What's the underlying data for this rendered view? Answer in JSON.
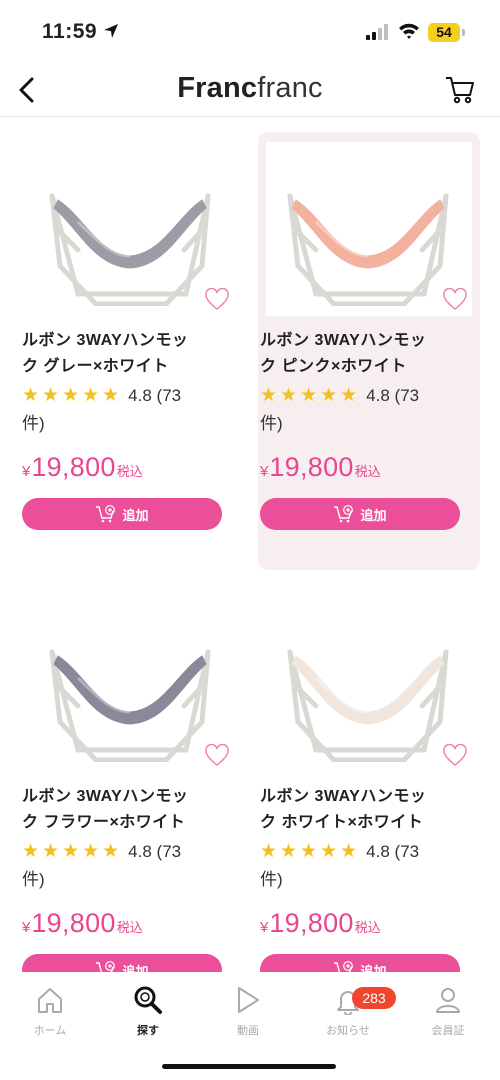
{
  "status": {
    "time": "11:59",
    "battery": "54"
  },
  "header": {
    "logo_bold": "Franc",
    "logo_thin": "franc"
  },
  "colors": {
    "accent": "#ec4f99",
    "price": "#e8468f",
    "star": "#f2c11d",
    "badge": "#f0452f",
    "selected_card_bg": "#f7efef"
  },
  "products": [
    {
      "name_line1": "ルボン 3WAYハンモッ",
      "name_line2": "ク グレー×ホワイト",
      "stars": "★★★★★",
      "rating": "4.8 (73",
      "rating_line2": "件)",
      "yen": "¥",
      "price": "19,800",
      "tax": "税込",
      "add_label": "追加",
      "fabric_color": "#9e9ba6",
      "selected": false
    },
    {
      "name_line1": "ルボン 3WAYハンモッ",
      "name_line2": "ク ピンク×ホワイト",
      "stars": "★★★★★",
      "rating": "4.8 (73",
      "rating_line2": "件)",
      "yen": "¥",
      "price": "19,800",
      "tax": "税込",
      "add_label": "追加",
      "fabric_color": "#f3b2a0",
      "selected": true
    },
    {
      "name_line1": "ルボン 3WAYハンモッ",
      "name_line2": "ク フラワー×ホワイト",
      "stars": "★★★★★",
      "rating": "4.8 (73",
      "rating_line2": "件)",
      "yen": "¥",
      "price": "19,800",
      "tax": "税込",
      "add_label": "追加",
      "fabric_color": "#8c8899",
      "selected": false
    },
    {
      "name_line1": "ルボン 3WAYハンモッ",
      "name_line2": "ク ホワイト×ホワイト",
      "stars": "★★★★★",
      "rating": "4.8 (73",
      "rating_line2": "件)",
      "yen": "¥",
      "price": "19,800",
      "tax": "税込",
      "add_label": "追加",
      "fabric_color": "#f1e6de",
      "selected": false
    }
  ],
  "tabbar": {
    "home": "ホーム",
    "search": "探す",
    "video": "動画",
    "news": "お知らせ",
    "news_badge": "283",
    "member": "会員証",
    "active": "search"
  }
}
